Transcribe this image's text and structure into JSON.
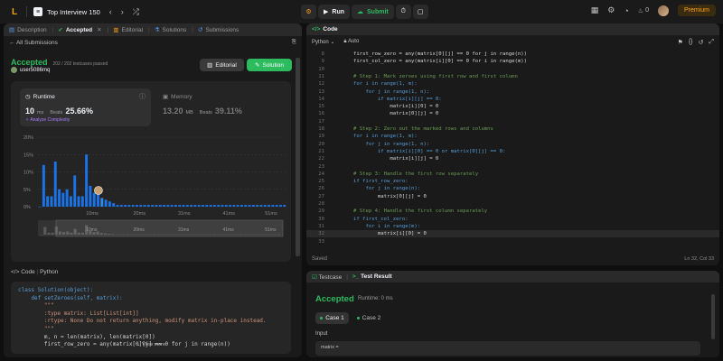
{
  "topbar": {
    "logo": "L",
    "problem_list_title": "Top Interview 150",
    "run_label": "Run",
    "submit_label": "Submit",
    "streak_count": "0",
    "premium_label": "Premium"
  },
  "left_tabs": [
    {
      "label": "Description",
      "icon": "description-icon"
    },
    {
      "label": "Accepted",
      "icon": "accepted-icon",
      "active": true
    },
    {
      "label": "Editorial",
      "icon": "editorial-icon"
    },
    {
      "label": "Solutions",
      "icon": "solutions-icon"
    },
    {
      "label": "Submissions",
      "icon": "submissions-icon"
    }
  ],
  "submission": {
    "back_label": "All Submissions",
    "status": "Accepted",
    "testcases": "202 / 202 testcases passed",
    "username": "user5086mq",
    "editorial_btn": "Editorial",
    "solution_btn": "Solution"
  },
  "runtime": {
    "label": "Runtime",
    "value": "10",
    "unit": "ms",
    "beats_label": "Beats",
    "beats_value": "25.66%",
    "complexity_label": "Analyze Complexity"
  },
  "memory": {
    "label": "Memory",
    "value": "13.20",
    "unit": "MB",
    "beats_label": "Beats",
    "beats_value": "39.11%"
  },
  "chart_data": {
    "type": "bar",
    "ylim": [
      0,
      20
    ],
    "yticks": [
      "20%",
      "15%",
      "10%",
      "5%",
      "0%"
    ],
    "xticks": [
      "10ms",
      "20ms",
      "31ms",
      "41ms",
      "51ms"
    ],
    "values": [
      0,
      12,
      3,
      3,
      13,
      5,
      4,
      5,
      3,
      9,
      3,
      3,
      15,
      6,
      4,
      5,
      2.5,
      2,
      1.5,
      1,
      0.5,
      0.5,
      0.5,
      0.5,
      0.5,
      0.5,
      0.5,
      0.5,
      0.5,
      0.5,
      0.5,
      0.5,
      0.5,
      0.5,
      0.5,
      0.5,
      0.5,
      0.5,
      0.5,
      0.5,
      0.5,
      0.5,
      0.5,
      0.5,
      0.5,
      0.5,
      0.5,
      0.5,
      0.5,
      0.5,
      0.5,
      0.5,
      0.5,
      0.5,
      0.5,
      0.5,
      0.5,
      0.5,
      0.5,
      0.5,
      0.5,
      0.5,
      0.5,
      0.5
    ],
    "highlight_index": 16,
    "bar_color": "#1a74e8",
    "minibar_xticks": [
      "10ms",
      "20ms",
      "31ms",
      "41ms",
      "51ms"
    ]
  },
  "code_section": {
    "label": "Code",
    "language": "Python",
    "lines": [
      "class Solution(object):",
      "    def setZeroes(self, matrix):",
      "        \"\"\"",
      "        :type matrix: List[List[int]]",
      "        :rtype: None Do not return anything, modify matrix in-place instead.",
      "        \"\"\"",
      "        m, n = len(matrix), len(matrix[0])",
      "        first_row_zero = any(matrix[0][j] == 0 for j in range(n))"
    ],
    "view_more": "View more"
  },
  "editor": {
    "title": "Code",
    "language": "Python",
    "mode": "Auto",
    "saved_label": "Saved",
    "cursor_pos": "Ln 32, Col 33",
    "lines": [
      {
        "n": "8",
        "t": "        first_row_zero = any(matrix[0][j] == 0 for j in range(n))",
        "c": "df"
      },
      {
        "n": "9",
        "t": "        first_col_zero = any(matrix[i][0] == 0 for i in range(m))",
        "c": "df"
      },
      {
        "n": "10",
        "t": "",
        "c": "df"
      },
      {
        "n": "11",
        "t": "        # Step 1: Mark zeroes using first row and first column",
        "c": "cm"
      },
      {
        "n": "12",
        "t": "        for i in range(1, m):",
        "c": "kw"
      },
      {
        "n": "13",
        "t": "            for j in range(1, n):",
        "c": "kw"
      },
      {
        "n": "14",
        "t": "                if matrix[i][j] == 0:",
        "c": "kw"
      },
      {
        "n": "15",
        "t": "                    matrix[i][0] = 0",
        "c": "df"
      },
      {
        "n": "16",
        "t": "                    matrix[0][j] = 0",
        "c": "df"
      },
      {
        "n": "17",
        "t": "",
        "c": "df"
      },
      {
        "n": "18",
        "t": "        # Step 2: Zero out the marked rows and columns",
        "c": "cm"
      },
      {
        "n": "19",
        "t": "        for i in range(1, m):",
        "c": "kw"
      },
      {
        "n": "20",
        "t": "            for j in range(1, n):",
        "c": "kw"
      },
      {
        "n": "21",
        "t": "                if matrix[i][0] == 0 or matrix[0][j] == 0:",
        "c": "kw"
      },
      {
        "n": "22",
        "t": "                    matrix[i][j] = 0",
        "c": "df"
      },
      {
        "n": "23",
        "t": "",
        "c": "df"
      },
      {
        "n": "24",
        "t": "        # Step 3: Handle the first row separately",
        "c": "cm"
      },
      {
        "n": "25",
        "t": "        if first_row_zero:",
        "c": "kw"
      },
      {
        "n": "26",
        "t": "            for j in range(n):",
        "c": "kw"
      },
      {
        "n": "27",
        "t": "                matrix[0][j] = 0",
        "c": "df"
      },
      {
        "n": "28",
        "t": "",
        "c": "df"
      },
      {
        "n": "29",
        "t": "        # Step 4: Handle the first column separately",
        "c": "cm"
      },
      {
        "n": "30",
        "t": "        if first_col_zero:",
        "c": "kw"
      },
      {
        "n": "31",
        "t": "            for i in range(m):",
        "c": "kw"
      },
      {
        "n": "32",
        "t": "                matrix[i][0] = 0",
        "c": "df"
      },
      {
        "n": "33",
        "t": "",
        "c": "df"
      }
    ]
  },
  "test_result": {
    "testcase_tab": "Testcase",
    "result_tab": "Test Result",
    "status": "Accepted",
    "runtime": "Runtime: 0 ms",
    "case1": "Case 1",
    "case2": "Case 2",
    "input_label": "Input",
    "input_value": "matrix ="
  }
}
